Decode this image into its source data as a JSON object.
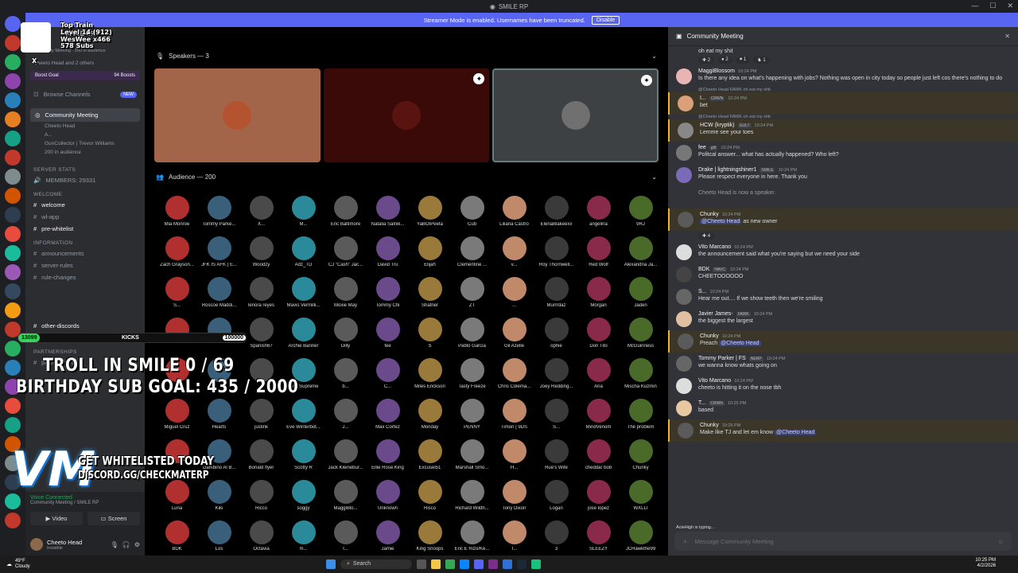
{
  "window": {
    "title": "SMILE RP"
  },
  "banner": {
    "text": "Streamer Mode is enabled. Usernames have been truncated.",
    "disable_label": "Disable"
  },
  "sidebar": {
    "server_name": "SMILE RP",
    "event_line1": "Community Meeting · 200 in audience",
    "event_line2": "Cheeto Head and 2 others",
    "boost_goal": "Boost Goal",
    "boost_count": "94 Boosts",
    "browse_channels": "Browse Channels",
    "new_badge": "NEW",
    "stage_channel": "Community Meeting",
    "stage_members": [
      "Cheeto Head",
      "A...",
      "GunCollector | Trevor Williams"
    ],
    "stage_audience": "200 in audience",
    "server_stats": "SERVER STATS",
    "members": "MEMBERS: 29331",
    "welcome_cat": "WELCOME",
    "channels_a": [
      "welcome",
      "wl-app",
      "pre-whitelist"
    ],
    "information_cat": "Information",
    "channels_b": [
      "announcements",
      "server-rules",
      "rule-changes"
    ],
    "channels_c": [
      "other-discords",
      "applications"
    ],
    "partnerships_cat": "Partnerships",
    "partnerships": "partnerships",
    "voice_connected": "Voice Connected",
    "voice_sub": "Community Meeting / SMILE RP",
    "video_label": "Video",
    "screen_label": "Screen",
    "user_name": "Cheeto Head",
    "user_status": "Invisible"
  },
  "stage": {
    "speakers_header": "Speakers — 3",
    "audience_header": "Audience — 200",
    "audience": [
      "Mia Monroe",
      "Tommy Parke...",
      "X...",
      "M...",
      "Eric Baltimore",
      "Natalia Salnik...",
      "YaBOIPeeta",
      "Cub",
      "Liliana Castro",
      "ElenaBlakeexx",
      "angelina",
      "9RJ",
      "Zach Grayson...",
      "JFK IS AFK | E...",
      "Woodzy",
      "Adz_TD",
      "CJ \"Cash\" Jac...",
      "David Tru",
      "Elijah",
      "Clementine ...",
      "v...",
      "Roy Thornwell...",
      "Red Wolf",
      "Alexandria Ja...",
      "S...",
      "Roscoe Maddi...",
      "lenora reyes",
      "Mavis Vermilli...",
      "Moxie May",
      "Tommy Chi",
      "Shatner",
      "ZT",
      "...",
      "Murrrdaz",
      "Morgan",
      "Jaden",
      "",
      "",
      "Spanish67",
      "Archie Banner",
      "Dilly",
      "fee",
      "S",
      "Pablo Garcia",
      "Gil Azelle",
      "ophie",
      "Don Tito",
      "McGuinness",
      "",
      "",
      "",
      "Eve_Supreme",
      "b...",
      "C...",
      "Miles Erickson",
      "Tasty Freeze",
      "Chris Colema...",
      "Joey Redding...",
      "Aria",
      "Mischa Kuzmin",
      "Miguel Cruz",
      "Hearts",
      "justink",
      "Eve Winterbot...",
      "J...",
      "Max Cortez",
      "Monday",
      "PENNY",
      "Timon | 9DS",
      "S...",
      "MindVenom",
      "The problem",
      "",
      "Gambino Al B...",
      "Bonald flyer",
      "Scotty R",
      "Jack Kleinebur...",
      "Ellie Rose King",
      "Excusel51",
      "Marshall Smo...",
      "H...",
      "Rue's Wife",
      "cheddar bob",
      "Chunky",
      "Luna",
      "Kiki",
      "Ricco",
      "soggy",
      "MaggiBlo...",
      "Unknown",
      "Risco",
      "Richard Wildh...",
      "Tony Dixon",
      "Logan",
      "jose lopez",
      "WXLLI",
      "BDK",
      "Los",
      "Octavia",
      "m...",
      "I...",
      "Jamie",
      "King Snoops",
      "Eric E Rizo/Ke...",
      "T...",
      "3",
      "SLEEZY",
      "JCHawkthe99"
    ]
  },
  "chat": {
    "title": "Community Meeting",
    "top_text": "oh eat my shit",
    "top_reacts": [
      "2",
      "2",
      "1",
      "1"
    ],
    "messages": [
      {
        "name": "MaggiBlossom",
        "time": "10:24 PM",
        "text": "Is there any idea on what's happening with jobs? Nothing was open in city today so people just left cos there's nothing to do",
        "hl": false,
        "reply": ""
      },
      {
        "name": "I...",
        "tag": "CRWN",
        "time": "10:24 PM",
        "text": "bet",
        "hl": true,
        "reply": "@Cheeto Head FAWK oh eat my shit"
      },
      {
        "name": "HCW (kryptik)",
        "tag": "GULT",
        "time": "10:24 PM",
        "text": "Lemme see your toes",
        "hl": true,
        "reply": "@Cheeto Head FAWK oh eat my shit"
      },
      {
        "name": "fee",
        "tag": "gift",
        "time": "10:24 PM",
        "text": "Politcal answer... what has actually happened? Who left?",
        "hl": false,
        "reply": ""
      },
      {
        "name": "Drake | lightningshiner1",
        "tag": "SMILE",
        "time": "10:24 PM",
        "text": "Please respect everyone in here. Thank you",
        "hl": false,
        "reply": ""
      },
      {
        "name": "",
        "time": "10:24 PM",
        "text": "Cheeto Head is now a speaker.",
        "hl": false,
        "reply": ""
      },
      {
        "name": "Chunky",
        "time": "10:24 PM",
        "text": "as new owner",
        "mention": "@Cheeto Head",
        "hl": true,
        "reply": "",
        "react": "4"
      },
      {
        "name": "Vito Marcano",
        "time": "10:24 PM",
        "text": "the announcement said what you're saying but we need your side",
        "hl": false,
        "reply": ""
      },
      {
        "name": "BDK",
        "tag": "HAVC",
        "time": "10:24 PM",
        "text": "CHEETOOOOOO",
        "hl": false,
        "reply": ""
      },
      {
        "name": "S...",
        "time": "10:24 PM",
        "text": "Hear me out.... If we show teeth then we're smiling",
        "hl": false,
        "reply": ""
      },
      {
        "name": "Javier James-",
        "tag": "FAWK",
        "time": "10:24 PM",
        "text": "the biggest the largest",
        "hl": false,
        "reply": ""
      },
      {
        "name": "Chunky",
        "time": "10:24 PM",
        "text": "Preach",
        "mention": "@Cheeto Head",
        "hl": true,
        "reply": ""
      },
      {
        "name": "Tommy Parker | FS",
        "tag": "NERP",
        "time": "10:24 PM",
        "text": "we wanna know whats going on",
        "hl": false,
        "reply": ""
      },
      {
        "name": "Vito Marcano",
        "time": "10:24 PM",
        "text": "cheeto is hitting it on the nose tbh",
        "hl": false,
        "reply": ""
      },
      {
        "name": "T...",
        "tag": "CRWN",
        "time": "10:25 PM",
        "text": "based",
        "hl": false,
        "reply": ""
      },
      {
        "name": "Chunky",
        "time": "10:25 PM",
        "text": "Make like TJ and let em know",
        "mention": "@Cheeto Head",
        "hl": true,
        "reply": ""
      }
    ],
    "typing": "AcieHigh is typing...",
    "input_placeholder": "Message Community Meeting"
  },
  "overlay": {
    "top_title": "Top Train",
    "top_level": "Level 14 (912)",
    "top_user": "WesWee x466",
    "top_subs": "578 Subs",
    "top_x": "X",
    "kicks_count": "13099",
    "kicks_label": "KICKS",
    "kicks_goal": "100000",
    "troll": "TROLL IN SMILE  0 / 69",
    "birthday": "BIRTHDAY SUB GOAL:  435 / 2000",
    "whitelist": "GET WHITELISTED TODAY",
    "discord": "DISCORD.GG/CHECKMATERP"
  },
  "taskbar": {
    "temp": "49°F",
    "weather": "Cloudy",
    "search": "Search",
    "time": "10:25 PM",
    "date": "4/2/2026"
  }
}
